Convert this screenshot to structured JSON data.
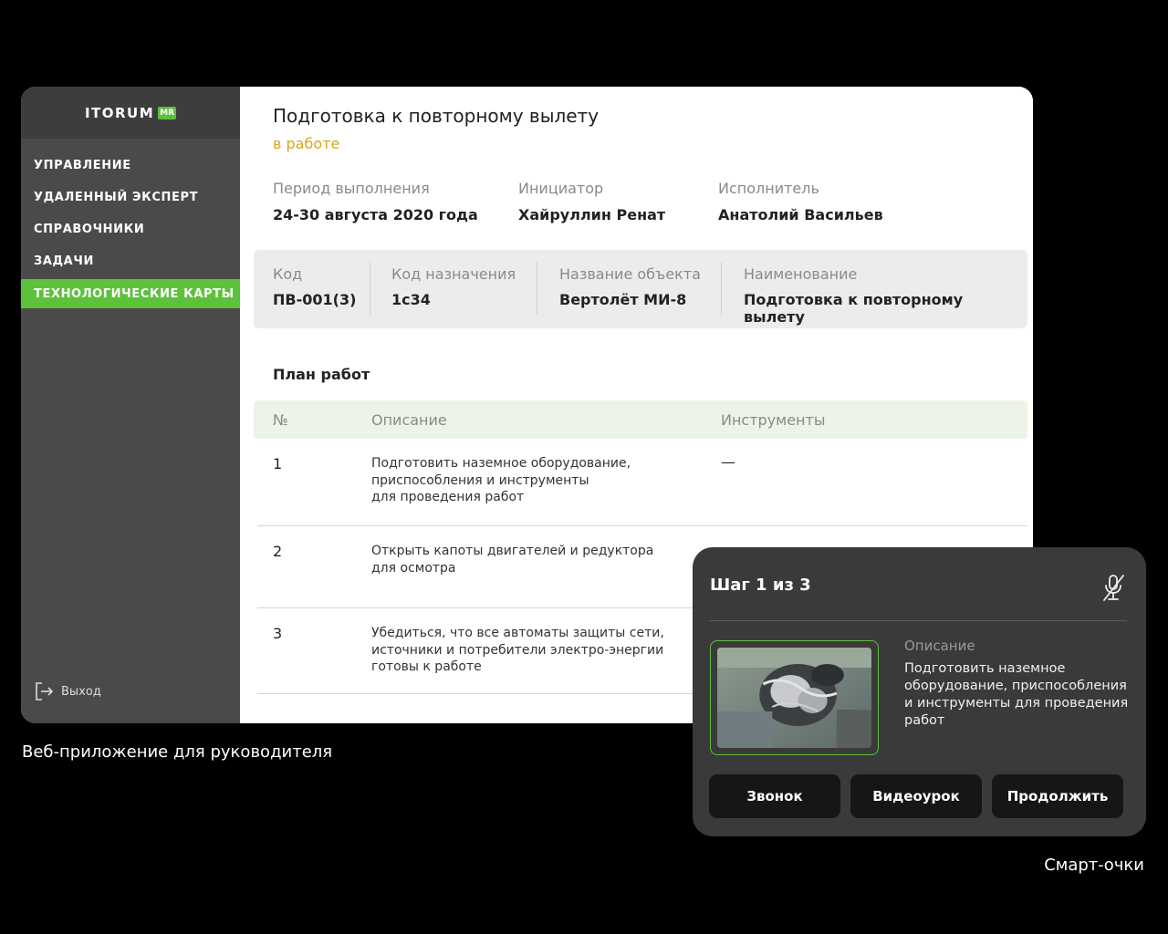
{
  "app": {
    "logo": "ITORUM",
    "logo_badge": "MR",
    "nav": [
      {
        "label": "УПРАВЛЕНИЕ"
      },
      {
        "label": "УДАЛЕННЫЙ ЭКСПЕРТ"
      },
      {
        "label": "СПРАВОЧНИКИ"
      },
      {
        "label": "ЗАДАЧИ"
      },
      {
        "label": "ТЕХНОЛОГИЧЕСКИЕ КАРТЫ",
        "active": true
      }
    ],
    "exit_label": "Выход",
    "accent_color": "#5cc23b"
  },
  "task": {
    "title": "Подготовка к повторному вылету",
    "status": "в работе",
    "status_color": "#d6a71e",
    "period_label": "Период выполнения",
    "period_value": "24-30 августа 2020 года",
    "initiator_label": "Инициатор",
    "initiator_value": "Хайруллин Ренат",
    "executor_label": "Исполнитель",
    "executor_value": "Анатолий Васильев"
  },
  "codes": {
    "code_label": "Код",
    "code_value": "ПВ-001(3)",
    "purpose_label": "Код назначения",
    "purpose_value": "1с34",
    "object_label": "Название объекта",
    "object_value": "Вертолёт МИ-8",
    "name_label": "Наименование",
    "name_value": "Подготовка к повторному вылету"
  },
  "plan": {
    "title": "План работ",
    "headers": {
      "num": "№",
      "desc": "Описание",
      "tools": "Инструменты"
    },
    "rows": [
      {
        "num": "1",
        "desc": "Подготовить наземное оборудование,\nприспособления и инструменты\nдля проведения работ",
        "tools": "—"
      },
      {
        "num": "2",
        "desc": "Открыть капоты двигателей и редуктора\nдля осмотра",
        "tools": ""
      },
      {
        "num": "3",
        "desc": "Убедиться, что все автоматы защиты сети,\nисточники и потребители электро-энергии\nготовы к работе",
        "tools": ""
      }
    ]
  },
  "captions": {
    "web": "Веб-приложение для руководителя",
    "glasses": "Смарт-очки"
  },
  "glasses": {
    "step": "Шаг 1 из 3",
    "mic_icon": "mic-off-icon",
    "desc_label": "Описание",
    "desc": "Подготовить наземное оборудование, приспособления и инструменты для проведения работ",
    "buttons": [
      "Звонок",
      "Видеоурок",
      "Продолжить"
    ]
  }
}
